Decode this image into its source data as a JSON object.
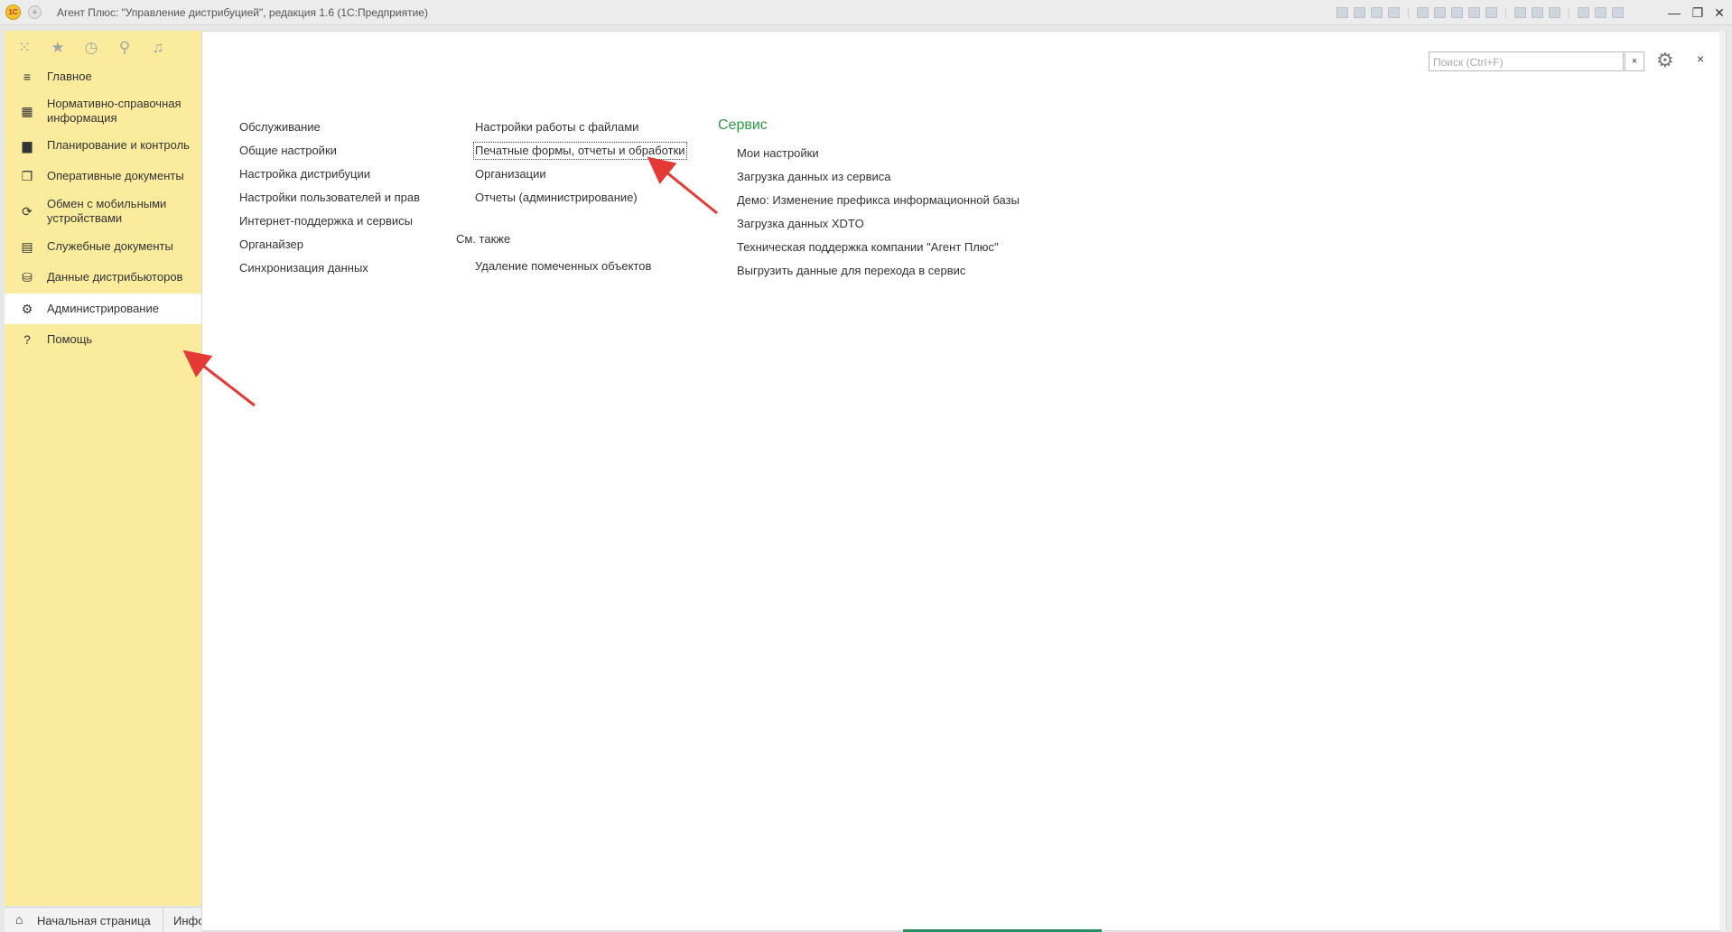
{
  "window": {
    "logo_text": "1С",
    "menu_glyph": "≡",
    "title": "Агент Плюс: \"Управление дистрибуцией\", редакция 1.6  (1С:Предприятие)",
    "controls": {
      "minimize": "—",
      "restore": "❐",
      "close": "✕"
    }
  },
  "sidebar": {
    "top_icons": [
      {
        "name": "apps-grid-icon",
        "glyph": "⁙"
      },
      {
        "name": "favorites-star-icon",
        "glyph": "★"
      },
      {
        "name": "history-icon",
        "glyph": "◷"
      },
      {
        "name": "search-icon",
        "glyph": "⚲"
      },
      {
        "name": "notifications-bell-icon",
        "glyph": "♫"
      }
    ],
    "items": [
      {
        "label": "Главное",
        "icon": "≡",
        "icon_name": "menu-lines-icon"
      },
      {
        "label": "Нормативно-справочная информация",
        "icon": "▦",
        "icon_name": "reference-grid-icon"
      },
      {
        "label": "Планирование и контроль",
        "icon": "▆",
        "icon_name": "bar-chart-icon"
      },
      {
        "label": "Оперативные документы",
        "icon": "❐",
        "icon_name": "documents-icon"
      },
      {
        "label": "Обмен с мобильными устройствами",
        "icon": "⟳",
        "icon_name": "sync-icon"
      },
      {
        "label": "Служебные документы",
        "icon": "▤",
        "icon_name": "service-documents-icon"
      },
      {
        "label": "Данные дистрибьюторов",
        "icon": "⛁",
        "icon_name": "distributor-data-icon"
      },
      {
        "label": "Администрирование",
        "icon": "⚙",
        "icon_name": "gear-icon"
      },
      {
        "label": "Помощь",
        "icon": "?",
        "icon_name": "help-icon"
      }
    ],
    "active_index": 7
  },
  "bottom_tabs": {
    "home_icon": "⌂",
    "home_label": "Начальная страница",
    "next_label": "Инфо"
  },
  "toolbar": {
    "search_placeholder": "Поиск (Ctrl+F)",
    "search_value": "",
    "clear_glyph": "×",
    "settings_glyph": "⚙",
    "close_glyph": "×"
  },
  "col1": [
    "Обслуживание",
    "Общие настройки",
    "Настройка дистрибуции",
    "Настройки пользователей и прав",
    "Интернет-поддержка и сервисы",
    "Органайзер",
    "Синхронизация данных"
  ],
  "col2": {
    "links": [
      "Настройки работы с файлами",
      "Печатные формы, отчеты и обработки",
      "Организации",
      "Отчеты (администрирование)"
    ],
    "see_also_title": "См. также",
    "see_also_links": [
      "Удаление помеченных объектов"
    ]
  },
  "col3": {
    "title": "Сервис",
    "links": [
      "Мои настройки",
      "Загрузка данных из сервиса",
      "Демо: Изменение префикса информационной базы",
      "Загрузка данных XDTO",
      "Техническая поддержка компании \"Агент Плюс\"",
      "Выгрузить данные для перехода в сервис"
    ]
  },
  "colors": {
    "sidebar_bg": "#fbec9d",
    "section_title": "#2d9a45",
    "annotation_arrow": "#e53935"
  }
}
